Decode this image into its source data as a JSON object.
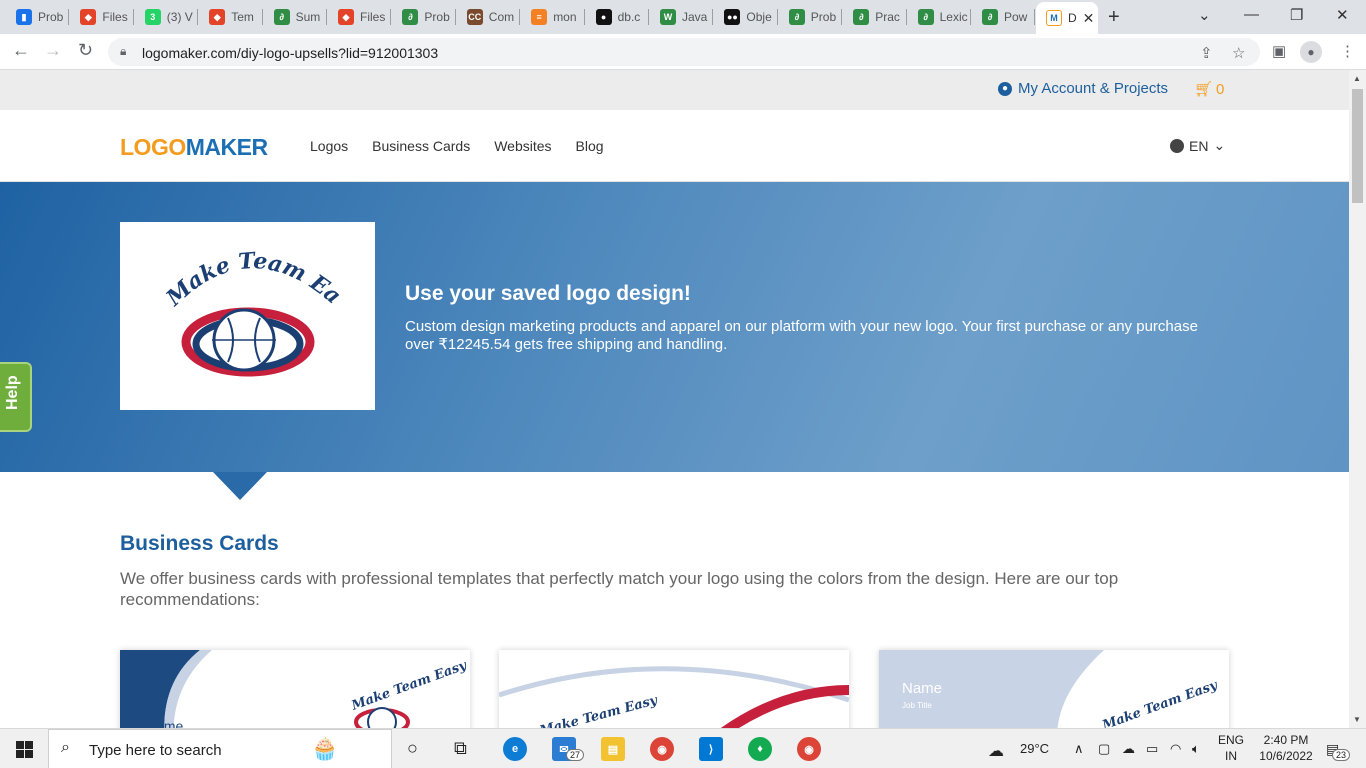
{
  "browser": {
    "tabs": [
      {
        "label": "Prob",
        "color": "#1a73e8",
        "glyph": "▮"
      },
      {
        "label": "Files",
        "color": "#e24329",
        "glyph": "◆"
      },
      {
        "label": "(3) V",
        "color": "#25d366",
        "glyph": "3"
      },
      {
        "label": "Tem",
        "color": "#e24329",
        "glyph": "◆"
      },
      {
        "label": "Sum",
        "color": "#2f8d46",
        "glyph": "∂"
      },
      {
        "label": "Files",
        "color": "#e24329",
        "glyph": "◆"
      },
      {
        "label": "Prob",
        "color": "#2f8d46",
        "glyph": "∂"
      },
      {
        "label": "Com",
        "color": "#7a4a2e",
        "glyph": "CC"
      },
      {
        "label": "mon",
        "color": "#f48024",
        "glyph": "≡"
      },
      {
        "label": "db.c",
        "color": "#111111",
        "glyph": "●"
      },
      {
        "label": "Java",
        "color": "#2f8d46",
        "glyph": "W"
      },
      {
        "label": "Obje",
        "color": "#111111",
        "glyph": "●●"
      },
      {
        "label": "Prob",
        "color": "#2f8d46",
        "glyph": "∂"
      },
      {
        "label": "Prac",
        "color": "#2f8d46",
        "glyph": "∂"
      },
      {
        "label": "Lexic",
        "color": "#2f8d46",
        "glyph": "∂"
      },
      {
        "label": "Pow",
        "color": "#2f8d46",
        "glyph": "∂"
      }
    ],
    "active_tab": {
      "label": "D",
      "glyph": "M",
      "color": "#f39c1f"
    },
    "new_tab_glyph": "+",
    "url": "logomaker.com/diy-logo-upsells?lid=912001303"
  },
  "site": {
    "account_label": "My Account & Projects",
    "cart_count": "0",
    "logo_part1": "LOGO",
    "logo_part2": "MAKER",
    "nav": [
      "Logos",
      "Business Cards",
      "Websites",
      "Blog"
    ],
    "language": "EN",
    "help_label": "Help"
  },
  "hero": {
    "logo_text": "Make Team Easy",
    "title": "Use your saved logo design!",
    "text": "Custom design marketing products and apparel on our platform with your new logo. Your first purchase or any purchase over ₹12245.54 gets free shipping and handling."
  },
  "business_cards": {
    "title": "Business Cards",
    "description": "We offer business cards with professional templates that perfectly match your logo using the colors from the design. Here are our top recommendations:",
    "card1_name": "Name",
    "card3_name": "Name",
    "card3_job": "Job Title"
  },
  "taskbar": {
    "search_placeholder": "Type here to search",
    "weather": "29°C",
    "lang_line1": "ENG",
    "lang_line2": "IN",
    "time": "2:40 PM",
    "date": "10/6/2022",
    "edge_badge": "27",
    "notif_badge": "23"
  }
}
